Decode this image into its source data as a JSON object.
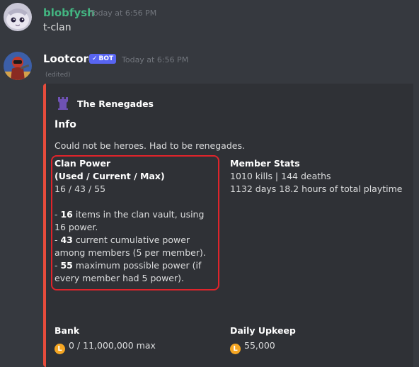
{
  "messages": [
    {
      "username": "blobfysh",
      "timestamp": "Today at 6:56 PM",
      "text": "t-clan",
      "username_color": "#43b581"
    },
    {
      "username": "Lootcord",
      "badge": "BOT",
      "timestamp": "Today at 6:56 PM",
      "edited": "(edited)",
      "username_color": "#ffffff"
    }
  ],
  "embed": {
    "accent_color": "#e74c3c",
    "author_icon": "castle-icon",
    "author": "The Renegades",
    "title": "Info",
    "description": "Could not be heroes. Had to be renegades.",
    "clan_power": {
      "name_line1": "Clan Power",
      "name_line2": "(Used / Current / Max)",
      "value": "16 / 43 / 55",
      "lines": [
        {
          "prefix": "- ",
          "number": "16",
          "rest": " items in the clan vault, using 16 power."
        },
        {
          "prefix": "- ",
          "number": "43",
          "rest": " current cumulative power among members (5 per member)."
        },
        {
          "prefix": "- ",
          "number": "55",
          "rest": " maximum possible power (if every member had 5 power)."
        }
      ]
    },
    "member_stats": {
      "name": "Member Stats",
      "line1": "1010 kills | 144 deaths",
      "line2": "1132 days 18.2 hours of total playtime"
    },
    "bank": {
      "name": "Bank",
      "value": "0 / 11,000,000 max",
      "icon": "coin-icon"
    },
    "upkeep": {
      "name": "Daily Upkeep",
      "value": "55,000",
      "icon": "coin-icon"
    }
  },
  "highlight_color": "#e0242b"
}
